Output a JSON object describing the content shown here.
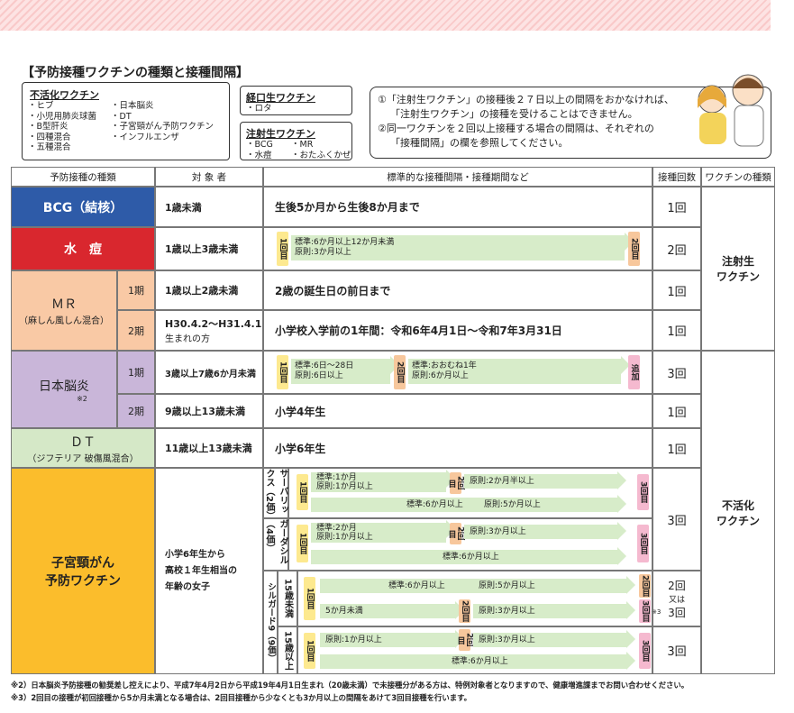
{
  "section_title": "【予防接種ワクチンの種類と接種間隔】",
  "inactive": {
    "title": "不活化ワクチン",
    "col1": [
      "・ヒブ",
      "・小児用肺炎球菌",
      "・B型肝炎",
      "・四種混合",
      "・五種混合"
    ],
    "col2": [
      "・日本脳炎",
      "・DT",
      "・子宮頸がん予防ワクチン",
      "・インフルエンザ"
    ]
  },
  "oral": {
    "title": "経口生ワクチン",
    "items": [
      "・ロタ"
    ]
  },
  "injection": {
    "title": "注射生ワクチン",
    "col1": [
      "・BCG",
      "・水痘"
    ],
    "col2": [
      "・MR",
      "・おたふくかぜ"
    ]
  },
  "notice": [
    "①「注射生ワクチン」の接種後２７日以上の間隔をおかなければ、",
    "「注射生ワクチン」の接種を受けることはできません。",
    "②同一ワクチンを２回以上接種する場合の間隔は、それぞれの",
    "「接種間隔」の欄を参照してください。"
  ],
  "headers": [
    "予防接種の種類",
    "対 象 者",
    "標準的な接種間隔・接種期間など",
    "接種回数",
    "ワクチンの種類"
  ],
  "rows": {
    "bcg": {
      "name": "BCG（結核）",
      "target": "1歳未満",
      "schedule": "生後5か月から生後8か月まで",
      "count": "1回",
      "color": "#2e5ba8"
    },
    "varicella": {
      "name": "水　痘",
      "target": "1歳以上3歳未満",
      "std": "標準:6か月以上12か月未満",
      "min": "原則:3か月以上",
      "count": "2回",
      "color": "#d9272e"
    },
    "mr": {
      "name": "ＭＲ",
      "sub": "（麻しん風しん混合）",
      "p1": "1期",
      "p2": "2期",
      "t1": "1歳以上2歳未満",
      "s1": "2歳の誕生日の前日まで",
      "t2a": "H30.4.2～H31.4.1",
      "t2b": "生まれの方",
      "s2": "小学校入学前の1年間：令和6年4月1日～令和7年3月31日",
      "c1": "1回",
      "c2": "1回",
      "color": "#f9c9a5"
    },
    "je": {
      "name": "日本脳炎",
      "note": "※2",
      "p1": "1期",
      "p2": "2期",
      "t1": "3歳以上7歳6か月未満",
      "std1": "標準:6日～28日",
      "min1": "原則:6日以上",
      "std2": "標準:おおむね1年",
      "min2": "原則:6か月以上",
      "add": "追加",
      "t2": "9歳以上13歳未満",
      "s2": "小学4年生",
      "c1": "3回",
      "c2": "1回",
      "color": "#c9b6d9"
    },
    "dt": {
      "name": "ＤＴ",
      "sub": "（ジフテリア 破傷風混合）",
      "target": "11歳以上13歳未満",
      "schedule": "小学6年生",
      "count": "1回",
      "color": "#d5e8c7"
    },
    "hpv": {
      "name1": "子宮頸がん",
      "name2": "予防ワクチン",
      "t1": "小学6年生から",
      "t2": "高校１年生相当の",
      "t3": "年齢の女子",
      "color": "#fbbd2c",
      "cervarix": "サーバリックス（2価）",
      "gardasil": "ガーダシル（4価）",
      "silgard": "シルガード9（9価）",
      "u15": "15歳未満",
      "o15": "15歳以上",
      "cv_std": "標準:1か月",
      "cv_min": "原則:1か月以上",
      "cv_min2": "原則:2か月半以上",
      "cv_std3": "標準:6か月以上",
      "cv_min3": "原則:5か月以上",
      "gd_std": "標準:2か月",
      "gd_min": "原則:1か月以上",
      "gd_min2": "原則:3か月以上",
      "gd_std3": "標準:6か月以上",
      "s9_std": "標準:6か月以上",
      "s9_min": "原則:5か月以上",
      "s9_u5": "5か月未満",
      "s9_min3": "原則:3か月以上",
      "s9_note": "※3",
      "s9o_min": "原則:1か月以上",
      "s9o_min2": "原則:3か月以上",
      "s9o_std": "標準:6か月以上",
      "c1": "3回",
      "c2a": "2回",
      "c2b": "又は",
      "c2c": "3回",
      "c3": "3回"
    }
  },
  "types": {
    "live": "注射生\nワクチン",
    "inactive": "不活化\nワクチン"
  },
  "doses": {
    "d1": "1回目",
    "d2": "2回目",
    "d3": "3回目"
  },
  "footnotes": [
    "※2）日本脳炎予防接種の勧奨差し控えにより、平成7年4月2日から平成19年4月1日生まれ（20歳未満）で未接種分がある方は、特例対象者となりますので、健康増進課までお問い合わせください。",
    "※3）2回目の接種が初回接種から5か月未満となる場合は、2回目接種から少なくとも3か月以上の間隔をあけて3回目接種を行います。"
  ]
}
